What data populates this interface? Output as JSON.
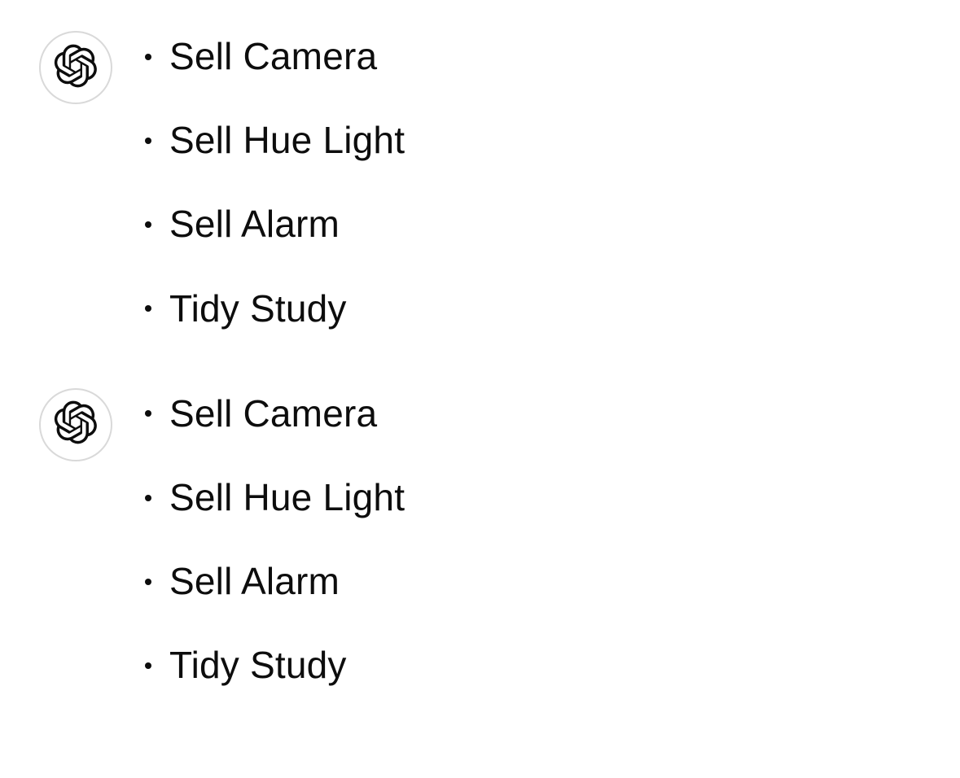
{
  "messages": [
    {
      "items": [
        "Sell Camera",
        "Sell Hue Light",
        "Sell Alarm",
        "Tidy Study"
      ]
    },
    {
      "items": [
        "Sell Camera",
        "Sell Hue Light",
        "Sell Alarm",
        "Tidy Study"
      ]
    }
  ]
}
